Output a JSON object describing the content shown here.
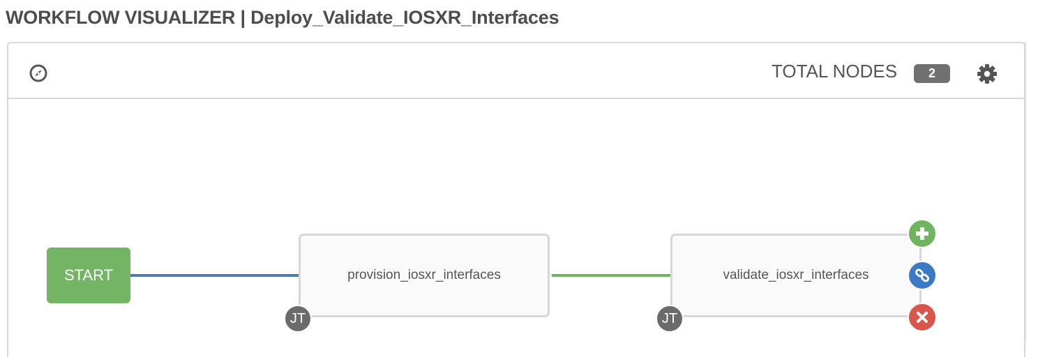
{
  "header": {
    "title": "WORKFLOW VISUALIZER | Deploy_Validate_IOSXR_Interfaces"
  },
  "toolbar": {
    "compass_icon": "compass-icon",
    "total_nodes_label": "TOTAL NODES",
    "total_nodes_count": "2",
    "settings_icon": "gear-icon"
  },
  "workflow": {
    "start_label": "START",
    "nodes": [
      {
        "label": "provision_iosxr_interfaces",
        "type_badge": "JT"
      },
      {
        "label": "validate_iosxr_interfaces",
        "type_badge": "JT"
      }
    ],
    "links": [
      {
        "from": "START",
        "to": "provision_iosxr_interfaces",
        "color": "#4a7eb0"
      },
      {
        "from": "provision_iosxr_interfaces",
        "to": "validate_iosxr_interfaces",
        "color": "#6fb560"
      }
    ],
    "node_actions": [
      {
        "name": "add",
        "icon": "plus-icon",
        "color": "#6fb560"
      },
      {
        "name": "link",
        "icon": "link-icon",
        "color": "#3b79c4"
      },
      {
        "name": "remove",
        "icon": "close-icon",
        "color": "#d9574a"
      }
    ]
  },
  "colors": {
    "start": "#73b465",
    "badge": "#707070",
    "border": "#d7d7d7"
  }
}
